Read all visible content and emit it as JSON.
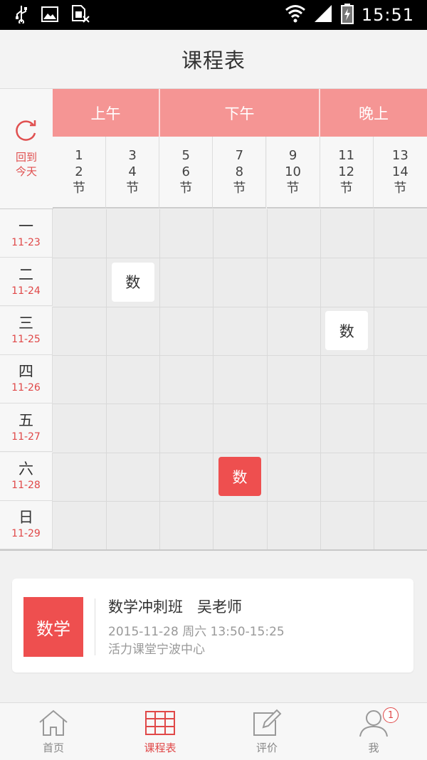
{
  "status_bar": {
    "time": "15:51"
  },
  "header": {
    "title": "课程表"
  },
  "corner": {
    "today_label_1": "回到",
    "today_label_2": "今天"
  },
  "periods": [
    {
      "label": "上午"
    },
    {
      "label": "下午"
    },
    {
      "label": "晚上"
    }
  ],
  "slots": [
    {
      "a": "1",
      "b": "2",
      "unit": "节"
    },
    {
      "a": "3",
      "b": "4",
      "unit": "节"
    },
    {
      "a": "5",
      "b": "6",
      "unit": "节"
    },
    {
      "a": "7",
      "b": "8",
      "unit": "节"
    },
    {
      "a": "9",
      "b": "10",
      "unit": "节"
    },
    {
      "a": "11",
      "b": "12",
      "unit": "节"
    },
    {
      "a": "13",
      "b": "14",
      "unit": "节"
    }
  ],
  "days": [
    {
      "name": "一",
      "date": "11-23"
    },
    {
      "name": "二",
      "date": "11-24"
    },
    {
      "name": "三",
      "date": "11-25"
    },
    {
      "name": "四",
      "date": "11-26"
    },
    {
      "name": "五",
      "date": "11-27"
    },
    {
      "name": "六",
      "date": "11-28"
    },
    {
      "name": "日",
      "date": "11-29"
    }
  ],
  "courses": [
    {
      "label": "数",
      "day": 1,
      "slot": 1,
      "style": "white"
    },
    {
      "label": "数",
      "day": 2,
      "slot": 5,
      "style": "white"
    },
    {
      "label": "数",
      "day": 5,
      "slot": 3,
      "style": "red"
    }
  ],
  "detail": {
    "subject": "数学",
    "title": "数学冲刺班   吴老师",
    "time": "2015-11-28 周六 13:50-15:25",
    "place": "活力课堂宁波中心"
  },
  "nav": [
    {
      "label": "首页",
      "icon": "home-icon"
    },
    {
      "label": "课程表",
      "icon": "schedule-grid-icon"
    },
    {
      "label": "评价",
      "icon": "edit-icon"
    },
    {
      "label": "我",
      "icon": "user-icon",
      "badge": "1"
    }
  ],
  "colors": {
    "accent": "#ee4f4f",
    "period_header": "#f59594"
  }
}
